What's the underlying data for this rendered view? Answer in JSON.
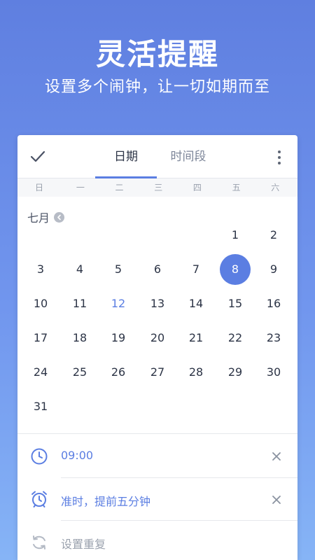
{
  "hero": {
    "title": "灵活提醒",
    "subtitle": "设置多个闹钟，让一切如期而至"
  },
  "toolbar": {
    "tabs": [
      "日期",
      "时间段"
    ],
    "active_tab": "日期"
  },
  "weekdays": [
    "日",
    "一",
    "二",
    "三",
    "四",
    "五",
    "六"
  ],
  "calendar": {
    "month_label": "七月",
    "first_weekday_index": 5,
    "days_in_month": 31,
    "today": 12,
    "selected": 8
  },
  "reminders": {
    "time": "09:00",
    "alarm": "准时，提前五分钟",
    "repeat": "设置重复"
  },
  "colors": {
    "accent": "#5b7ee2",
    "text": "#2c3446",
    "muted": "#9aa1ad"
  }
}
